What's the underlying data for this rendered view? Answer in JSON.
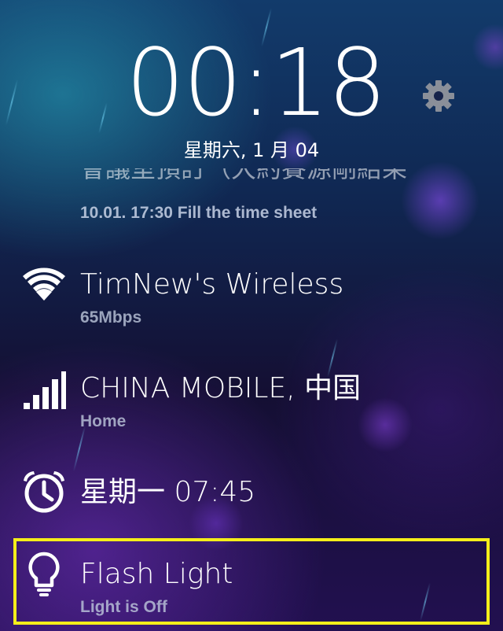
{
  "lockscreen": {
    "time": "00:18",
    "date": "星期六, 1 月 04",
    "settings_icon": "gear-icon"
  },
  "reminder": {
    "title_partial": "會議室預訂（大約賽源剛結果",
    "subtitle": "10.01. 17:30 Fill the time sheet"
  },
  "widgets": [
    {
      "icon": "wifi-icon",
      "title": "TimNew's Wireless",
      "subtitle": "65Mbps"
    },
    {
      "icon": "cell-signal-icon",
      "title": "CHINA MOBILE, 中国",
      "subtitle": "Home"
    },
    {
      "icon": "alarm-clock-icon",
      "title": "星期一 07:45",
      "subtitle": ""
    },
    {
      "icon": "lightbulb-icon",
      "title": "Flash Light",
      "subtitle": "Light is Off"
    }
  ],
  "colors": {
    "highlight": "#f5ee1a"
  }
}
